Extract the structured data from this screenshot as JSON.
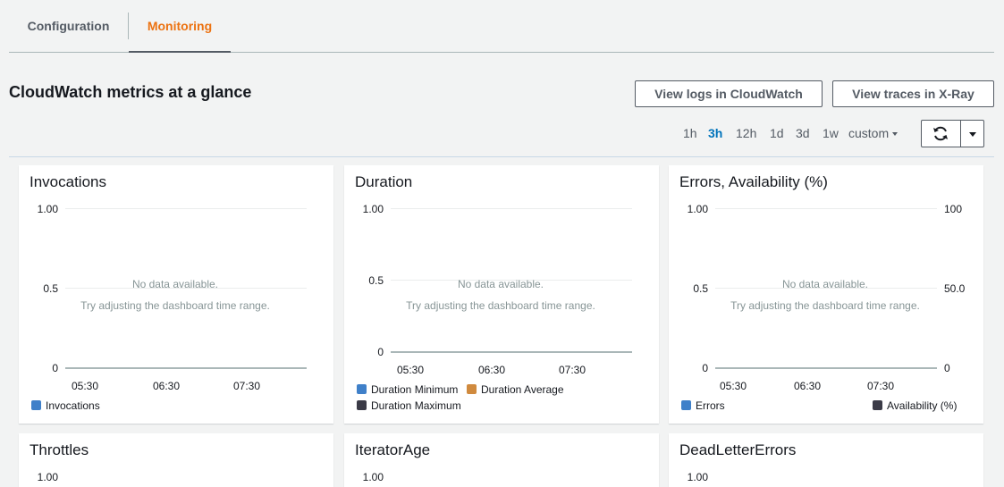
{
  "tabs": [
    {
      "label": "Configuration",
      "active": false
    },
    {
      "label": "Monitoring",
      "active": true
    }
  ],
  "header": {
    "title": "CloudWatch metrics at a glance",
    "view_logs_label": "View logs in CloudWatch",
    "view_traces_label": "View traces in X-Ray"
  },
  "time_ranges": {
    "options": [
      "1h",
      "3h",
      "12h",
      "1d",
      "3d",
      "1w",
      "custom"
    ],
    "selected": "3h"
  },
  "icons": {
    "refresh": "refresh-icon",
    "dropdown": "caret-down-icon"
  },
  "colors": {
    "accent": "#0073bb",
    "tab_active": "#ec7211",
    "series_blue": "#3f80c9",
    "series_orange": "#d08a3e",
    "series_dark": "#3b3b47"
  },
  "empty_state": {
    "line1": "No data available.",
    "line2": "Try adjusting the dashboard time range."
  },
  "widgets": [
    {
      "title": "Invocations",
      "y_ticks": [
        "1.00",
        "0.5",
        "0"
      ],
      "x_ticks": [
        "05:30",
        "06:30",
        "07:30"
      ],
      "legend": [
        {
          "label": "Invocations",
          "color": "#3f80c9"
        }
      ]
    },
    {
      "title": "Duration",
      "y_ticks": [
        "1.00",
        "0.5",
        "0"
      ],
      "x_ticks": [
        "05:30",
        "06:30",
        "07:30"
      ],
      "legend": [
        {
          "label": "Duration Minimum",
          "color": "#3f80c9"
        },
        {
          "label": "Duration Average",
          "color": "#d08a3e"
        },
        {
          "label": "Duration Maximum",
          "color": "#3b3b47"
        }
      ]
    },
    {
      "title": "Errors, Availability (%)",
      "y_ticks": [
        "1.00",
        "0.5",
        "0"
      ],
      "y_ticks_right": [
        "100",
        "50.0",
        "0"
      ],
      "x_ticks": [
        "05:30",
        "06:30",
        "07:30"
      ],
      "legend": [
        {
          "label": "Errors",
          "color": "#3f80c9"
        },
        {
          "label": "Availability (%)",
          "color": "#3b3b47"
        }
      ]
    },
    {
      "title": "Throttles",
      "y_ticks": [
        "1.00"
      ]
    },
    {
      "title": "IteratorAge",
      "y_ticks": [
        "1.00"
      ]
    },
    {
      "title": "DeadLetterErrors",
      "y_ticks": [
        "1.00"
      ]
    }
  ]
}
